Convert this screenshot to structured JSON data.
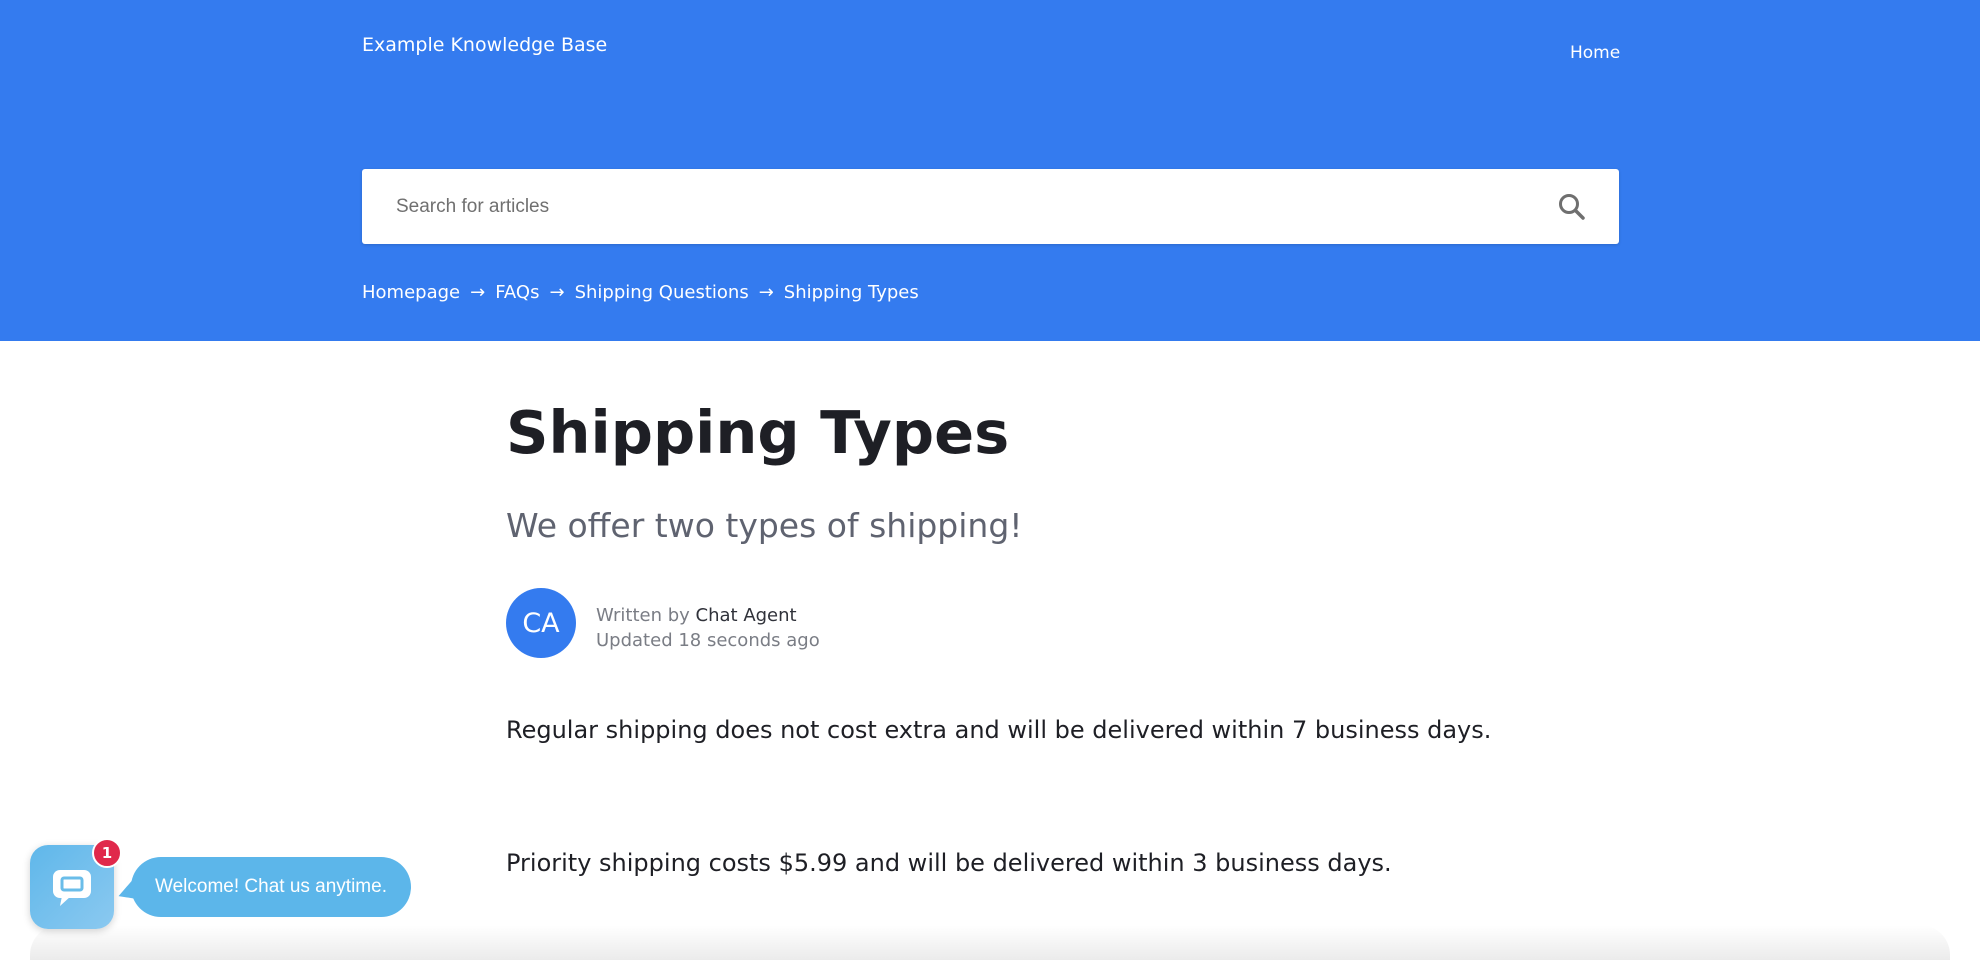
{
  "header": {
    "brand": "Example Knowledge Base",
    "nav_home": "Home",
    "color": "#347BEF"
  },
  "search": {
    "placeholder": "Search for articles",
    "value": "",
    "icon": "search-icon"
  },
  "breadcrumb": {
    "items": [
      "Homepage",
      "FAQs",
      "Shipping Questions",
      "Shipping Types"
    ],
    "separator": "→"
  },
  "article": {
    "title": "Shipping Types",
    "subtitle": "We offer two types of shipping!",
    "author_initials": "CA",
    "written_by_label": "Written by",
    "author_name": "Chat Agent",
    "updated": "Updated 18 seconds ago",
    "paragraphs": [
      "Regular shipping does not cost extra and will be delivered within 7 business days.",
      "Priority shipping costs $5.99 and will be delivered within 3 business days."
    ]
  },
  "chat_widget": {
    "badge_count": "1",
    "welcome": "Welcome! Chat us anytime.",
    "icon": "chat-icon",
    "color": "#5CB6EA",
    "badge_color": "#E0294B"
  }
}
